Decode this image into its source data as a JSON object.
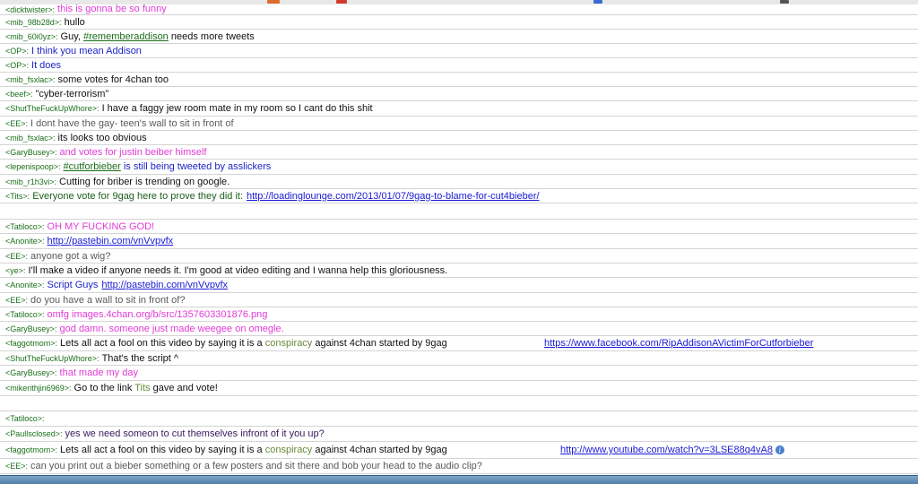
{
  "colors": {
    "nick": "#1a6e1a",
    "blue": "#1d24c4",
    "pink": "#e23ad6",
    "gray": "#5a5a5a",
    "link": "#1a1ad6"
  },
  "rows": {
    "r0": {
      "nick": "<dicktwister>:",
      "text": "this is gonna be so funny"
    },
    "r1": {
      "nick": "<mib_98b28d>:",
      "text": "hullo"
    },
    "r2": {
      "nick": "<mib_60i0yz>:",
      "pre": "Guy,",
      "hashtag": "#rememberaddison",
      "post": "needs more tweets"
    },
    "r3": {
      "nick": "<OP>:",
      "text": "I think you mean Addison"
    },
    "r4": {
      "nick": "<OP>:",
      "text": "It does"
    },
    "r5": {
      "nick": "<mib_fsxlac>:",
      "text": "some votes for 4chan too"
    },
    "r6": {
      "nick": "<beef>:",
      "text": "\"cyber-terrorism\""
    },
    "r7": {
      "nick": "<ShutTheFuckUpWhore>:",
      "text": "I have a faggy jew room mate in my room so I cant do this shit"
    },
    "r8": {
      "nick": "<EE>:",
      "text": "I dont have the gay- teen's wall to sit in front of"
    },
    "r9": {
      "nick": "<mib_fsxlac>:",
      "text": "its looks too obvious"
    },
    "r10": {
      "nick": "<GaryBusey>:",
      "text": "and votes for justin beiber himself"
    },
    "r11": {
      "nick": "<lepenispoop>:",
      "hashtag": "#cutforbieber",
      "post": "is still being tweeted by asslickers"
    },
    "r12": {
      "nick": "<mib_r1h3vi>:",
      "text": "Cutting for briber is trending on google."
    },
    "r13": {
      "nick": "<Tits>:",
      "text": "Everyone vote for 9gag here to prove they did it:",
      "link": "http://loadinglounge.com/2013/01/07/9gag-to-blame-for-cut4bieber/"
    },
    "r14": {
      "nick": "",
      "text": ""
    },
    "r15": {
      "nick": "<Tatiloco>:",
      "text": "OH MY FUCKING GOD!"
    },
    "r16": {
      "nick": "<Anonite>:",
      "link": "http://pastebin.com/vnVvpvfx"
    },
    "r17": {
      "nick": "<EE>:",
      "text": "anyone got a wig?"
    },
    "r18": {
      "nick": "<ye>:",
      "text": "I'll make a video if anyone needs it. I'm good at video editing and I wanna help this gloriousness."
    },
    "r19": {
      "nick": "<Anonite>:",
      "text": "Script Guys",
      "link": "http://pastebin.com/vnVvpvfx"
    },
    "r20": {
      "nick": "<EE>:",
      "text": "do you have a wall to sit in front of?"
    },
    "r21": {
      "nick": "<Tatiloco>:",
      "text": "omfg images.4chan.org/b/src/1357603301876.png"
    },
    "r22": {
      "nick": "<GaryBusey>:",
      "text": "god damn. someone just made weegee on omegle."
    },
    "r23": {
      "nick": "<faggotmom>:",
      "pre": "Lets all act a fool on this video by saying it is a",
      "highlight": "conspiracy",
      "post": "against 4chan started by 9gag",
      "link": "https://www.facebook.com/RipAddisonAVictimForCutforbieber"
    },
    "r24": {
      "nick": "<ShutTheFuckUpWhore>:",
      "text": "That's the script ^"
    },
    "r25": {
      "nick": "<GaryBusey>:",
      "text": "that made my day"
    },
    "r26": {
      "nick": "<mikerithjin6969>:",
      "pre": "Go to the link",
      "highlight": "Tits",
      "post": "gave and vote!"
    },
    "r27": {
      "nick": "",
      "text": ""
    },
    "r28": {
      "nick": "<Tatiloco>:",
      "text": ""
    },
    "r29": {
      "nick": "<Paullsclosed>:",
      "text": "yes we need someon to cut themselves infront of it you up?"
    },
    "r30": {
      "nick": "<faggotmom>:",
      "pre": "Lets all act a fool on this video by saying it is a",
      "highlight": "conspiracy",
      "post": "against 4chan started by 9gag",
      "link": "http://www.youtube.com/watch?v=3LSE88q4vA8"
    },
    "r31": {
      "nick": "<EE>:",
      "text": "can you print out a bieber something or a few posters and sit there and bob your head to the audio clip?"
    }
  }
}
